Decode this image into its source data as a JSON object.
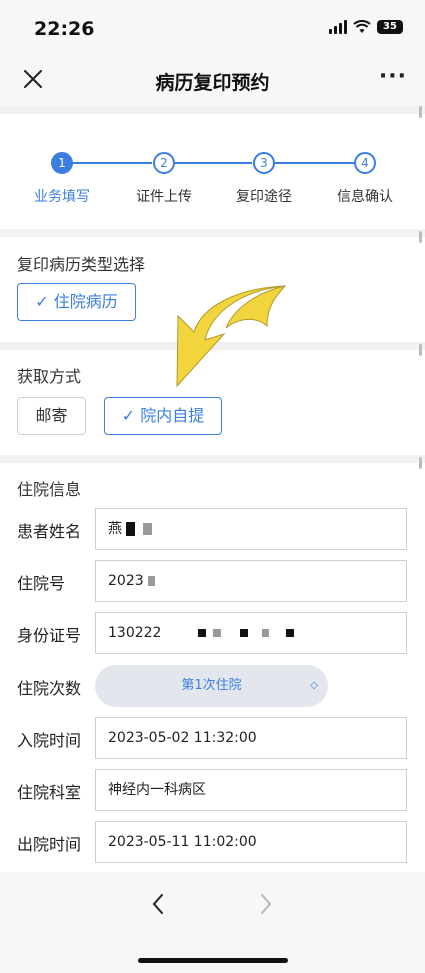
{
  "status": {
    "time": "22:26",
    "battery": "35"
  },
  "nav": {
    "title": "病历复印预约"
  },
  "steps": [
    {
      "num": "1",
      "label": "业务填写"
    },
    {
      "num": "2",
      "label": "证件上传"
    },
    {
      "num": "3",
      "label": "复印途径"
    },
    {
      "num": "4",
      "label": "信息确认"
    }
  ],
  "record_type": {
    "title": "复印病历类型选择",
    "option": "住院病历"
  },
  "pickup": {
    "title": "获取方式",
    "option_mail": "邮寄",
    "option_self": "院内自提"
  },
  "hospital_info": {
    "title": "住院信息",
    "patient_name": {
      "label": "患者姓名",
      "value": "燕"
    },
    "admission_no": {
      "label": "住院号",
      "value": "2023"
    },
    "id_no": {
      "label": "身份证号",
      "value": "130222"
    },
    "visit_count": {
      "label": "住院次数",
      "value": "第1次住院"
    },
    "admit_time": {
      "label": "入院时间",
      "value": "2023-05-02 11:32:00"
    },
    "department": {
      "label": "住院科室",
      "value": "神经内一科病区"
    },
    "discharge_time": {
      "label": "出院时间",
      "value": "2023-05-11 11:02:00"
    }
  },
  "colors": {
    "accent": "#3a7fe0",
    "arrow": "#f2d43c"
  },
  "icons": {
    "close": "close-icon",
    "more": "more-icon",
    "back": "chevron-left-icon",
    "forward": "chevron-right-icon"
  }
}
